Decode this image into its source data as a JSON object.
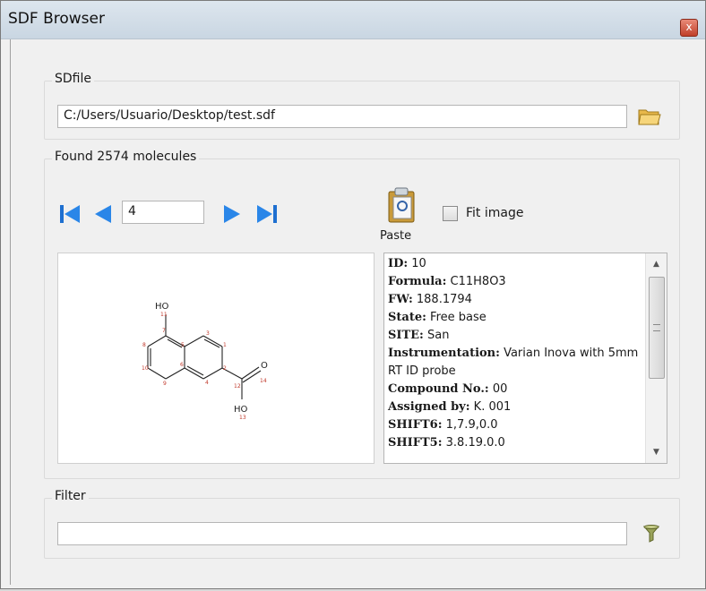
{
  "window": {
    "title": "SDF Browser",
    "close_glyph": "x"
  },
  "sdfile": {
    "group_label": "SDfile",
    "path": "C:/Users/Usuario/Desktop/test.sdf",
    "browse_icon": "folder-open-icon"
  },
  "molecules": {
    "group_label": "Found 2574 molecules",
    "current_index": "4",
    "paste_label": "Paste",
    "fit_image_label": "Fit image",
    "fit_image_checked": false
  },
  "structure": {
    "atoms": [
      "HO",
      "11",
      "7",
      "8",
      "6",
      "5",
      "4",
      "3",
      "2",
      "1",
      "9",
      "10",
      "12",
      "O",
      "14",
      "HO",
      "13"
    ]
  },
  "info": {
    "rows": [
      {
        "key": "ID:",
        "value": " 10"
      },
      {
        "key": "Formula:",
        "value": " C11H8O3"
      },
      {
        "key": "FW:",
        "value": " 188.1794"
      },
      {
        "key": "State:",
        "value": " Free base"
      },
      {
        "key": "SITE:",
        "value": " San"
      },
      {
        "key": "Instrumentation:",
        "value": " Varian Inova with 5mm RT ID probe"
      },
      {
        "key": "Compound No.:",
        "value": " 00"
      },
      {
        "key": "Assigned by:",
        "value": " K. 001"
      },
      {
        "key": "SHIFT6:",
        "value": " 1,7.9,0.0"
      },
      {
        "key": "SHIFT5:",
        "value": " 3.8.19.0.0"
      }
    ]
  },
  "filter": {
    "group_label": "Filter",
    "value": "",
    "icon": "filter-funnel-icon"
  }
}
